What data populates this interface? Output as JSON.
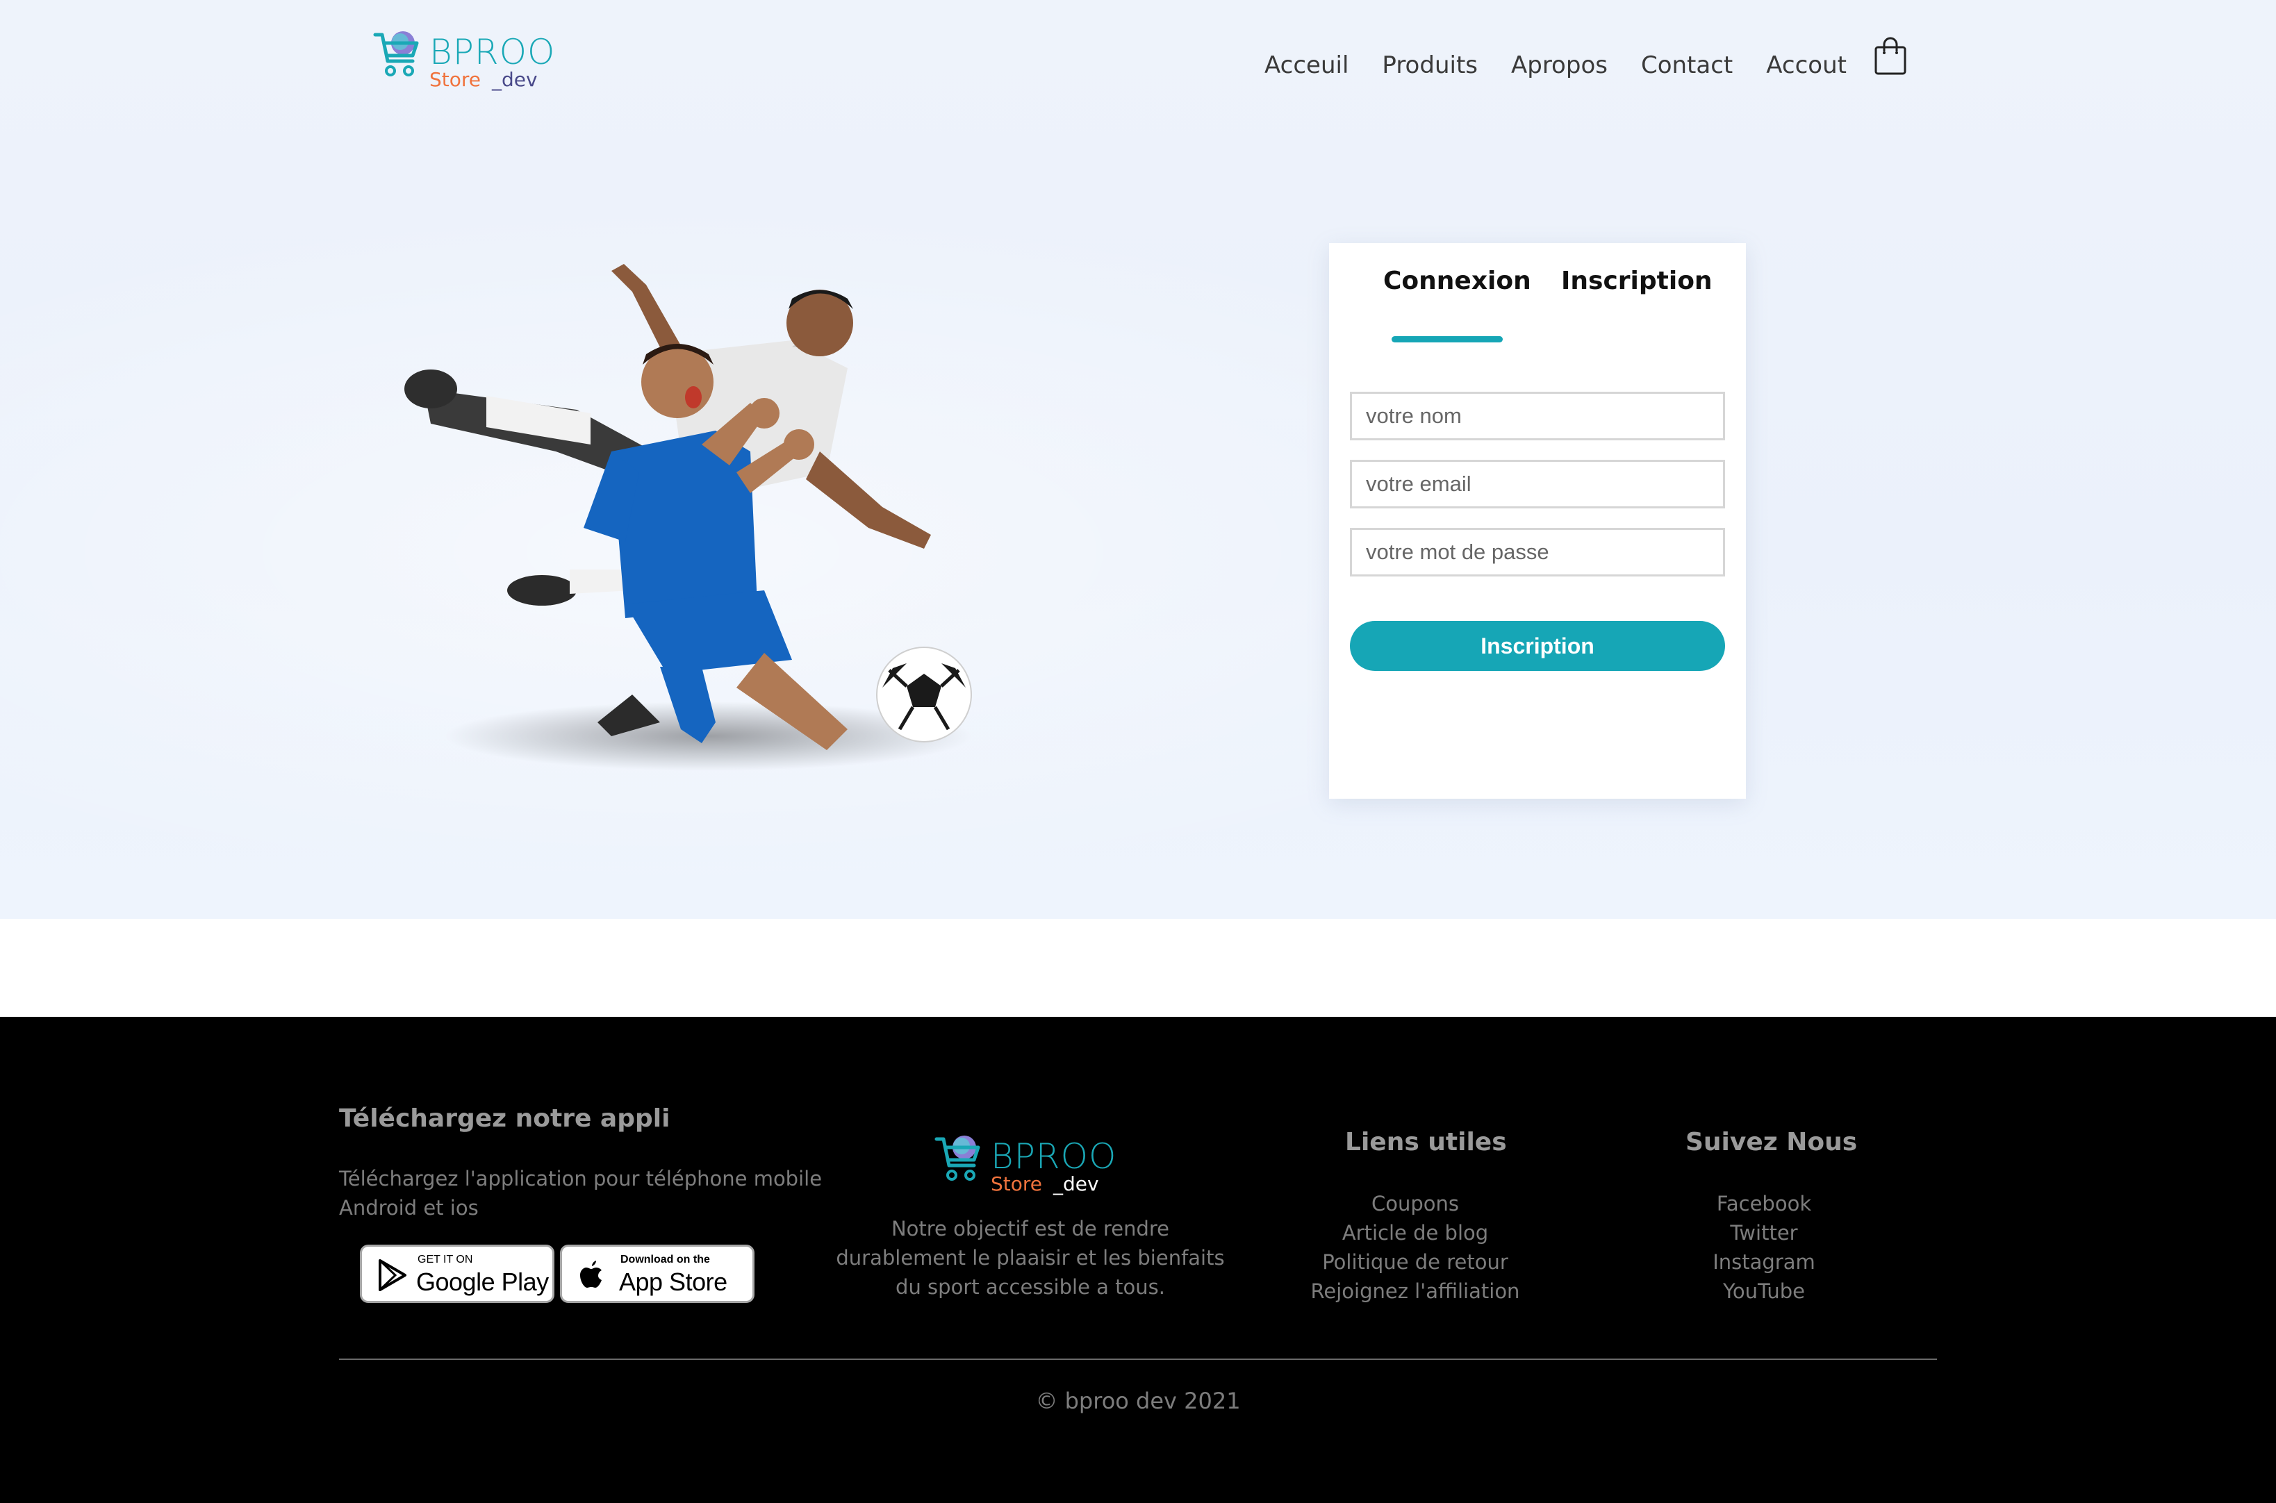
{
  "header": {
    "logo": {
      "brand": "BPROO",
      "store": "Store",
      "dev": "_dev"
    },
    "nav": [
      "Acceuil",
      "Produits",
      "Apropos",
      "Contact",
      "Accout"
    ],
    "cart_icon": "shopping-bag-icon"
  },
  "auth_card": {
    "tabs": {
      "login": "Connexion",
      "register": "Inscription"
    },
    "active_tab": "Connexion",
    "fields": {
      "name_placeholder": "votre nom",
      "email_placeholder": "votre email",
      "password_placeholder": "votre mot de passe"
    },
    "submit_label": "Inscription",
    "accent_color": "#16a6b6"
  },
  "footer": {
    "app": {
      "title": "Téléchargez notre appli",
      "description": "Téléchargez l'application pour téléphone mobile Android et ios",
      "google_play": {
        "small": "GET IT ON",
        "big": "Google Play"
      },
      "app_store": {
        "small": "Download on the",
        "big": "App Store"
      }
    },
    "logo": {
      "brand": "BPROO",
      "store": "Store",
      "dev": "_dev"
    },
    "mission": "Notre objectif est de rendre durablement le plaaisir et les bienfaits du sport accessible a tous.",
    "links": {
      "title": "Liens utiles",
      "items": [
        "Coupons",
        "Article de blog",
        "Politique de retour",
        "Rejoignez l'affiliation"
      ]
    },
    "follow": {
      "title": "Suivez Nous",
      "items": [
        "Facebook",
        "Twitter",
        "Instagram",
        "YouTube"
      ]
    },
    "copyright": "© bproo dev 2021"
  }
}
